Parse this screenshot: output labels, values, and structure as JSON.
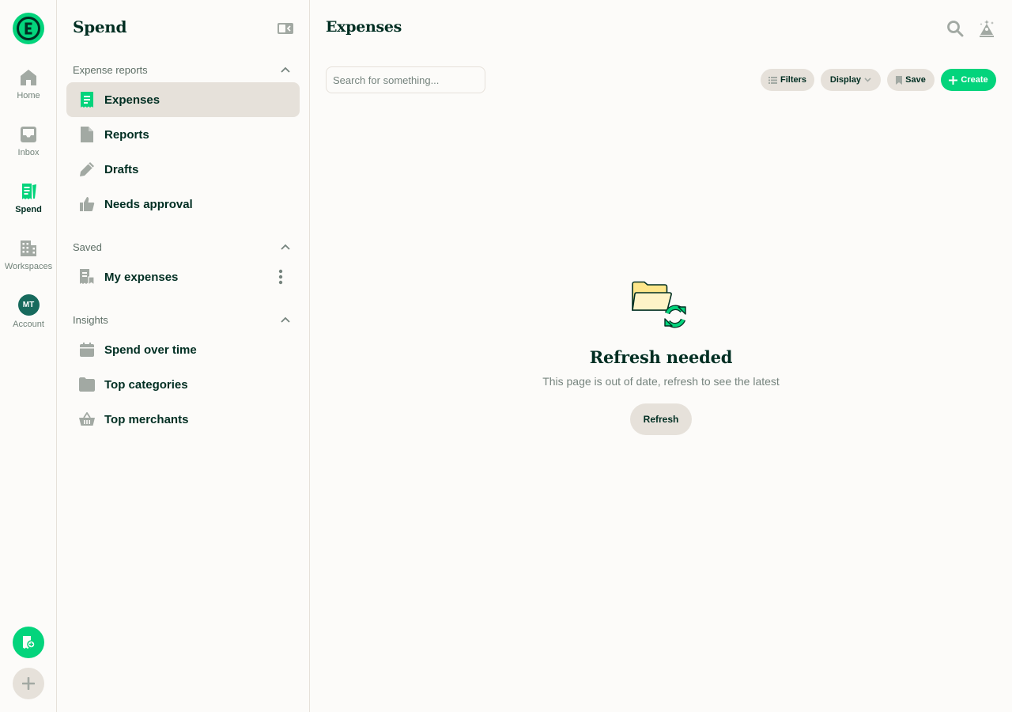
{
  "rail": {
    "items": [
      {
        "label": "Home",
        "icon": "home-icon"
      },
      {
        "label": "Inbox",
        "icon": "inbox-icon"
      },
      {
        "label": "Spend",
        "icon": "receipt-icon",
        "active": true
      },
      {
        "label": "Workspaces",
        "icon": "building-icon"
      },
      {
        "label": "Account",
        "icon": "avatar"
      }
    ],
    "avatar_initials": "MT"
  },
  "sidebar": {
    "title": "Spend",
    "sections": [
      {
        "heading": "Expense reports",
        "items": [
          {
            "label": "Expenses",
            "icon": "receipt-icon",
            "active": true
          },
          {
            "label": "Reports",
            "icon": "document-icon"
          },
          {
            "label": "Drafts",
            "icon": "pencil-icon"
          },
          {
            "label": "Needs approval",
            "icon": "thumbs-up-icon"
          }
        ]
      },
      {
        "heading": "Saved",
        "items": [
          {
            "label": "My expenses",
            "icon": "bookmark-receipt-icon"
          }
        ]
      },
      {
        "heading": "Insights",
        "items": [
          {
            "label": "Spend over time",
            "icon": "calendar-icon"
          },
          {
            "label": "Top categories",
            "icon": "folder-icon"
          },
          {
            "label": "Top merchants",
            "icon": "basket-icon"
          }
        ]
      }
    ]
  },
  "main": {
    "title": "Expenses",
    "search_placeholder": "Search for something...",
    "toolbar": {
      "filters": "Filters",
      "display": "Display",
      "save": "Save",
      "create": "Create"
    },
    "empty_state": {
      "title": "Refresh needed",
      "subtitle": "This page is out of date, refresh to see the latest",
      "button": "Refresh"
    }
  },
  "colors": {
    "accent": "#03d47c",
    "text": "#002e22",
    "muted": "#76847e",
    "surface": "#e6e1da",
    "background": "#fcfbf9"
  }
}
